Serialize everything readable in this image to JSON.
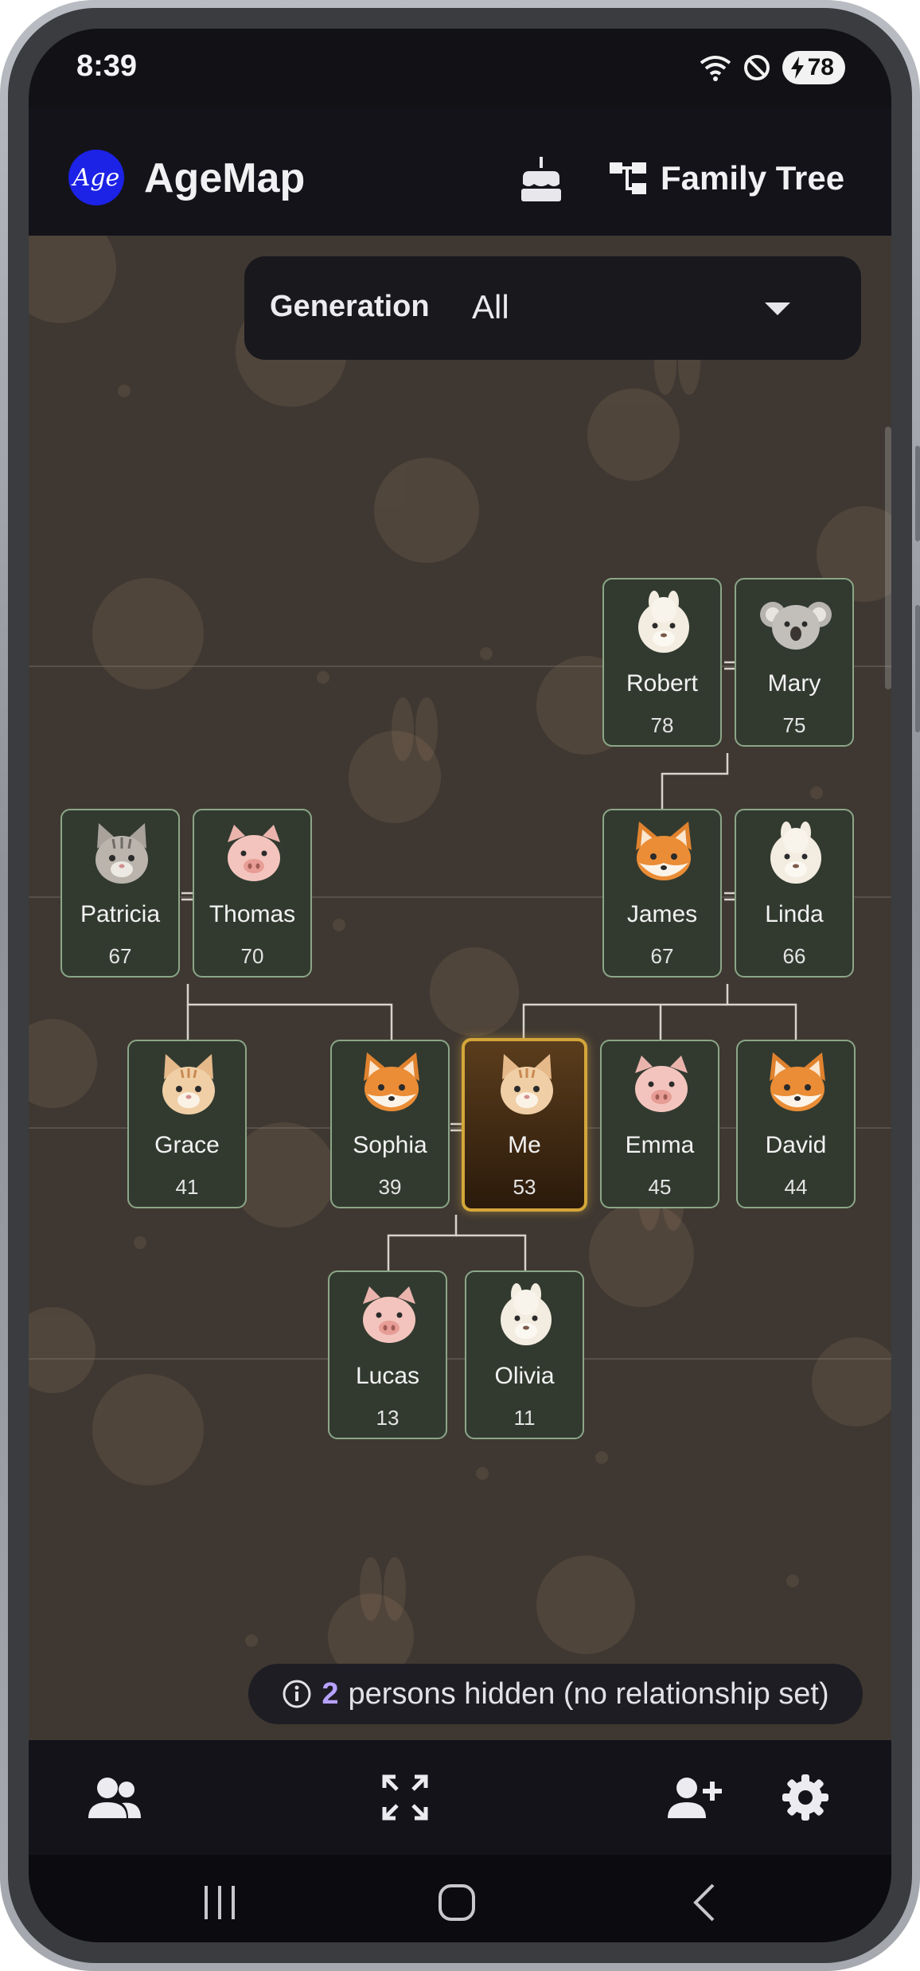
{
  "status_bar": {
    "time": "8:39",
    "battery": "78"
  },
  "app_bar": {
    "title": "AgeMap",
    "logo_text": "Age",
    "tree_button_label": "Family Tree"
  },
  "generation_filter": {
    "label": "Generation",
    "value": "All"
  },
  "people": [
    {
      "name": "Robert",
      "age": "78",
      "animal": "alpaca"
    },
    {
      "name": "Mary",
      "age": "75",
      "animal": "koala"
    },
    {
      "name": "Patricia",
      "age": "67",
      "animal": "tabby-cat"
    },
    {
      "name": "Thomas",
      "age": "70",
      "animal": "pig"
    },
    {
      "name": "James",
      "age": "67",
      "animal": "fox"
    },
    {
      "name": "Linda",
      "age": "66",
      "animal": "alpaca"
    },
    {
      "name": "Grace",
      "age": "41",
      "animal": "orange-cat"
    },
    {
      "name": "Sophia",
      "age": "39",
      "animal": "fox"
    },
    {
      "name": "Me",
      "age": "53",
      "animal": "orange-cat",
      "highlighted": true
    },
    {
      "name": "Emma",
      "age": "45",
      "animal": "pig"
    },
    {
      "name": "David",
      "age": "44",
      "animal": "fox"
    },
    {
      "name": "Lucas",
      "age": "13",
      "animal": "pig"
    },
    {
      "name": "Olivia",
      "age": "11",
      "animal": "alpaca"
    }
  ],
  "hidden_notice": {
    "count": "2",
    "text": "persons hidden (no relationship set)"
  },
  "icons": {
    "app_bar": [
      "cake-icon",
      "account-tree-icon"
    ],
    "bottom_bar": [
      "people-icon",
      "fit-screen-icon",
      "add-person-icon",
      "settings-icon"
    ],
    "nav_bar": [
      "recents-icon",
      "home-icon",
      "back-icon"
    ]
  },
  "colors": {
    "accent": "#d4a63a",
    "count_highlight": "#b7a2ff",
    "logo": "#1c22e6",
    "node_border": "#8ba687"
  }
}
